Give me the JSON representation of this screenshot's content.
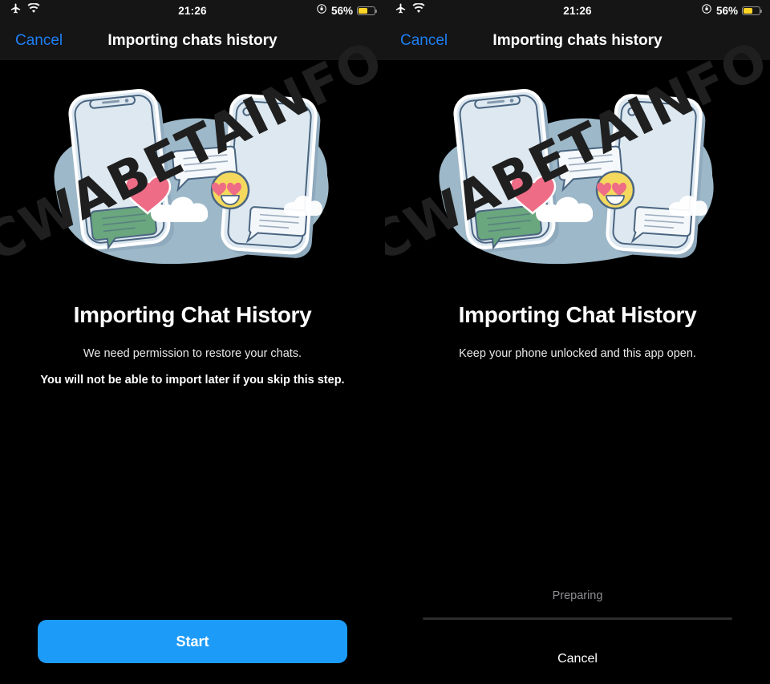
{
  "statusbar": {
    "airplane_icon": "airplane-icon",
    "wifi_icon": "wifi-icon",
    "time": "21:26",
    "rotation_lock_icon": "rotation-lock-icon",
    "battery_percent": "56%",
    "battery_level": 56,
    "battery_color": "#fdd426"
  },
  "navbar": {
    "cancel_label": "Cancel",
    "title": "Importing chats history",
    "tint_color": "#1d7ff4"
  },
  "illustration": {
    "name": "two-phones-transfer-illustration",
    "blob_color": "#9db8c8",
    "phone_body_color": "#dde8f0",
    "phone_outline_color": "#4a6581",
    "heart_color": "#ee6c86",
    "emoji_color": "#f4d95e",
    "green_bubble_color": "#6aa67e",
    "cloud_color": "#ffffff"
  },
  "screen_a": {
    "title": "Importing Chat History",
    "subtitle": "We need permission to restore your chats.",
    "warning": "You will not be able to import later if you skip this step.",
    "start_label": "Start",
    "start_color": "#1d9bf8"
  },
  "screen_b": {
    "title": "Importing Chat History",
    "subtitle": "Keep your phone unlocked and this app open.",
    "progress_label": "Preparing",
    "progress_percent": 0,
    "cancel_label": "Cancel"
  },
  "watermark": {
    "text": "CWABETAINFO",
    "color": "#1f1f1f"
  }
}
